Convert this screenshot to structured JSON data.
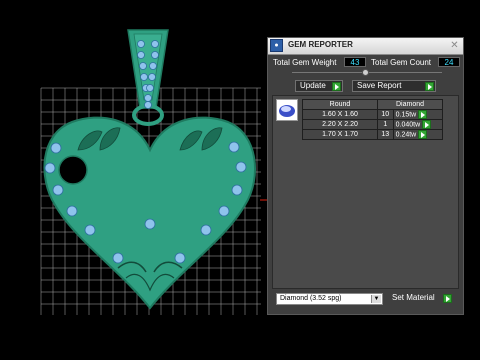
{
  "panel": {
    "title": "GEM REPORTER",
    "close_icon": "close-icon",
    "total_weight_label": "Total Gem Weight",
    "total_weight_value": "43",
    "total_count_label": "Total Gem Count",
    "total_count_value": "24",
    "update_label": "Update",
    "save_report_label": "Save Report",
    "table": {
      "headers": [
        "Round",
        "Diamond"
      ],
      "rows": [
        {
          "size": "1.60 X 1.60",
          "count": "10",
          "weight": "0.15tw"
        },
        {
          "size": "2.20 X 2.20",
          "count": "1",
          "weight": "0.040tw"
        },
        {
          "size": "1.70 X 1.70",
          "count": "13",
          "weight": "0.24tw"
        }
      ]
    },
    "material_select": "Diamond    (3.52 spg)",
    "set_material_label": "Set Material"
  },
  "colors": {
    "model_green": "#2fa082",
    "model_dark": "#1f7a60",
    "gem_blue": "#8fc3ec",
    "grid": "#d0d0d0",
    "accent_go": "#33a534"
  }
}
